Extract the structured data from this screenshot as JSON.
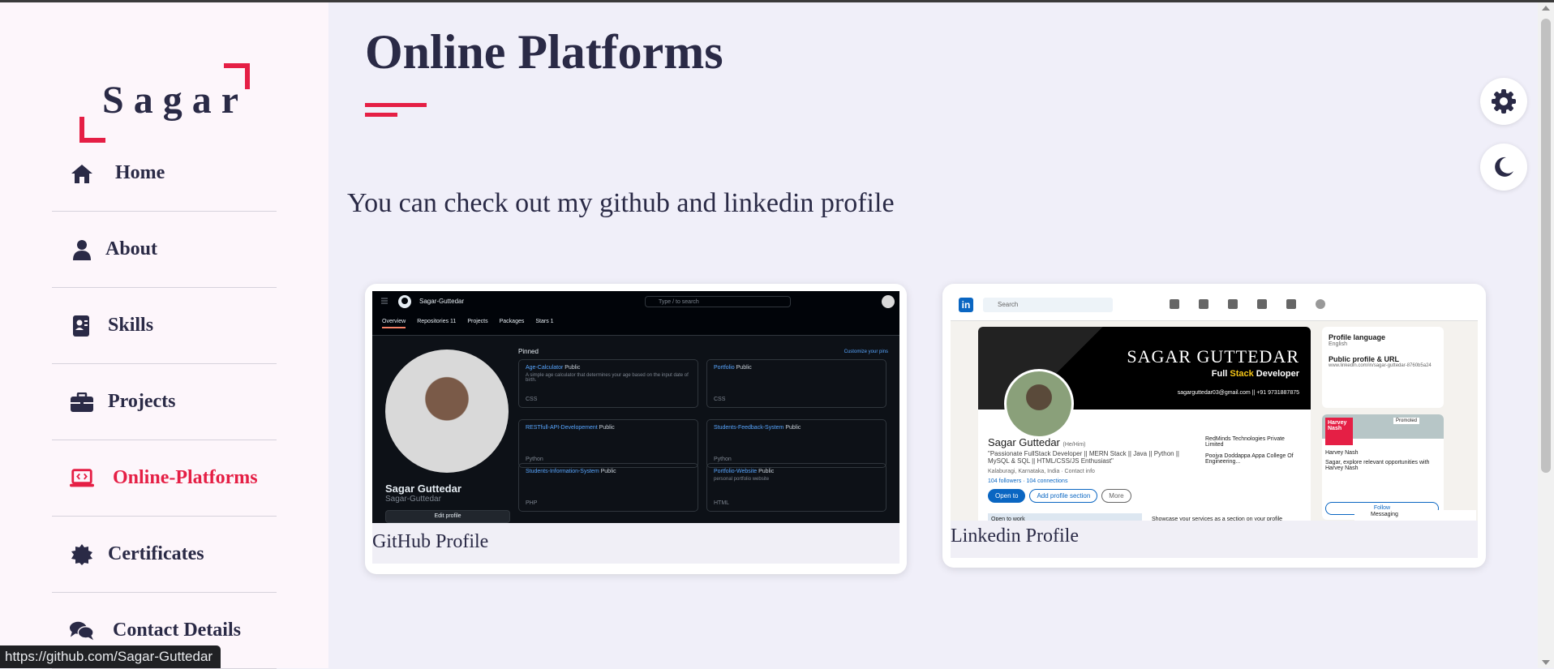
{
  "colors": {
    "accent": "#e51f45",
    "text": "#2a2a46",
    "background": "#f0eff9",
    "sidebar": "#fdf6fb"
  },
  "logo": {
    "text": "Sagar"
  },
  "nav": {
    "items": [
      {
        "label": "Home",
        "icon": "home-icon"
      },
      {
        "label": "About",
        "icon": "user-icon"
      },
      {
        "label": "Skills",
        "icon": "id-badge-icon"
      },
      {
        "label": "Projects",
        "icon": "briefcase-icon"
      },
      {
        "label": "Online-Platforms",
        "icon": "laptop-code-icon",
        "active": true
      },
      {
        "label": "Certificates",
        "icon": "certificate-icon"
      },
      {
        "label": "Contact Details",
        "icon": "comments-icon"
      }
    ]
  },
  "main": {
    "title": "Online Platforms",
    "subtitle": "You can check out my github and linkedin profile",
    "cards": [
      {
        "caption": "GitHub Profile"
      },
      {
        "caption": "Linkedin Profile"
      }
    ]
  },
  "github": {
    "username": "Sagar-Guttedar",
    "search_placeholder": "Type / to search",
    "tabs": [
      "Overview",
      "Repositories 11",
      "Projects",
      "Packages",
      "Stars 1"
    ],
    "display_name": "Sagar Guttedar",
    "handle": "Sagar-Guttedar",
    "edit_label": "Edit profile",
    "pinned_label": "Pinned",
    "customize_label": "Customize your pins",
    "repos": [
      {
        "name": "Age-Calculator",
        "badge": "Public",
        "desc": "A simple age calculator that determines your age based on the input date of birth.",
        "lang": "CSS"
      },
      {
        "name": "Portfolio",
        "badge": "Public",
        "desc": "",
        "lang": "CSS"
      },
      {
        "name": "RESTfull-API-Developement",
        "badge": "Public",
        "desc": "",
        "lang": "Python"
      },
      {
        "name": "Students-Feedback-System",
        "badge": "Public",
        "desc": "",
        "lang": "Python"
      },
      {
        "name": "Students-Information-System",
        "badge": "Public",
        "desc": "",
        "lang": "PHP"
      },
      {
        "name": "Portfolio-Website",
        "badge": "Public",
        "desc": "personal portfolio website",
        "lang": "HTML"
      }
    ]
  },
  "linkedin": {
    "search_placeholder": "Search",
    "banner_title": "SAGAR GUTTEDAR",
    "banner_sub_a": "Full ",
    "banner_sub_b": "Stack",
    "banner_sub_c": " Developer",
    "banner_contact": "sagarguttedar03@gmail.com  ||  +91 9731887875",
    "name": "Sagar Guttedar",
    "pronoun": "(He/Him)",
    "headline": "\"Passionate FullStack Developer || MERN Stack || Java || Python || MySQL & SQL || HTML/CSS/JS Enthusiast\"",
    "location": "Kalaburagi, Karnataka, India · Contact info",
    "connections": "104 followers · 104 connections",
    "btn_open": "Open to",
    "btn_add": "Add profile section",
    "btn_more": "More",
    "company1": "RedMinds Technologies Private Limited",
    "company2": "Poojya Doddappa Appa College Of Engineering...",
    "side_lang_title": "Profile language",
    "side_lang_value": "English",
    "side_url_title": "Public profile & URL",
    "side_url_value": "www.linkedin.com/in/sagar-guttedar-8760b5a24",
    "ad_brand": "Harvey Nash",
    "ad_text": "Sagar, explore relevant opportunities with Harvey Nash",
    "ad_follow": "Follow",
    "promoted": "Promoted",
    "messaging": "Messaging",
    "open_to_work": "Open to work",
    "showcase": "Showcase your services as a section on your profile"
  },
  "status_url": "https://github.com/Sagar-Guttedar"
}
